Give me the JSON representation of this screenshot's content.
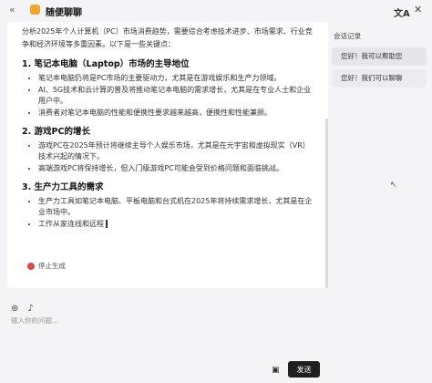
{
  "header": {
    "title": "随便聊聊",
    "translate_label": "文A"
  },
  "message": {
    "intro": "分析2025年个人计算机（PC）市场消费趋势，需要综合考虑技术进步、市场需求、行业竞争和经济环境等多重因素。以下是一些关键点：",
    "sections": [
      {
        "title": "1. 笔记本电脑（Laptop）市场的主导地位",
        "bullets": [
          "笔记本电脑仍将是PC市场的主要驱动力，尤其是在游戏娱乐和生产力领域。",
          "AI、5G技术和云计算的普及将推动笔记本电脑的需求增长，尤其是在专业人士和企业用户中。",
          "消费者对笔记本电脑的性能和便携性要求越来越高，便携性和性能兼顾。"
        ]
      },
      {
        "title": "2. 游戏PC的增长",
        "bullets": [
          "游戏PC在2025年预计将继续主导个人娱乐市场，尤其是在元宇宙和虚拟现实（VR）技术兴起的情况下。",
          "高端游戏PC将保持增长，但入门级游戏PC可能会受到价格问题和面临挑战。"
        ]
      },
      {
        "title": "3. 生产力工具的需求",
        "bullets": [
          "生产力工具如笔记本电脑、平板电脑和台式机在2025年将持续需求增长，尤其是在企业市场中。",
          "工作从家连线和远程"
        ]
      }
    ],
    "stop_label": "停止生成"
  },
  "sidebar": {
    "heading": "会话记录",
    "items": [
      {
        "label": "您好！我可以帮助您"
      },
      {
        "label": "您好！我们可以聊聊"
      }
    ]
  },
  "composer": {
    "placeholder": "输入你的问题...",
    "send_label": "发送"
  }
}
